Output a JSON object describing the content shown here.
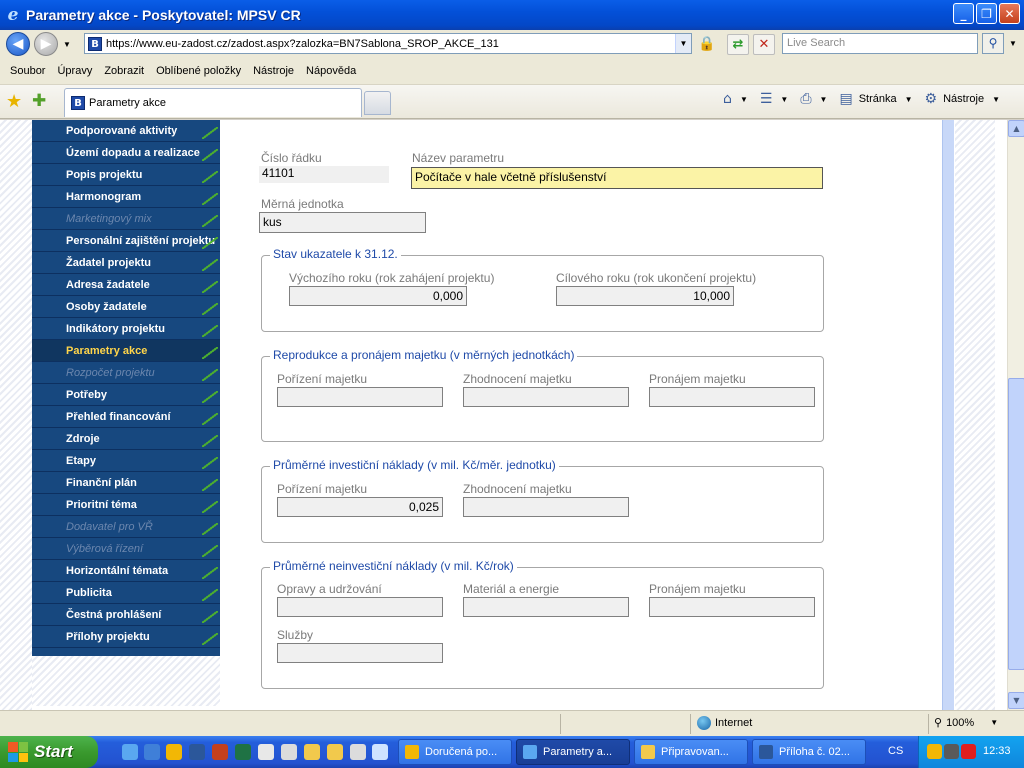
{
  "window": {
    "title": "Parametry akce - Poskytovatel: MPSV CR"
  },
  "address_bar": {
    "url": "https://www.eu-zadost.cz/zadost.aspx?zalozka=BN7Sablona_SROP_AKCE_131",
    "search_placeholder": "Live Search"
  },
  "menu": [
    "Soubor",
    "Úpravy",
    "Zobrazit",
    "Oblíbené položky",
    "Nástroje",
    "Nápověda"
  ],
  "tab": {
    "label": "Parametry akce"
  },
  "commands": {
    "page": "Stránka",
    "tools": "Nástroje"
  },
  "sidebar": {
    "items": [
      {
        "label": "Podporované aktivity",
        "state": "normal"
      },
      {
        "label": "Území dopadu a realizace",
        "state": "normal"
      },
      {
        "label": "Popis projektu",
        "state": "normal"
      },
      {
        "label": "Harmonogram",
        "state": "normal"
      },
      {
        "label": "Marketingový mix",
        "state": "disabled"
      },
      {
        "label": "Personální zajištění projektu",
        "state": "normal"
      },
      {
        "label": "Žadatel projektu",
        "state": "normal"
      },
      {
        "label": "Adresa žadatele",
        "state": "normal"
      },
      {
        "label": "Osoby žadatele",
        "state": "normal"
      },
      {
        "label": "Indikátory projektu",
        "state": "normal"
      },
      {
        "label": "Parametry akce",
        "state": "active"
      },
      {
        "label": "Rozpočet projektu",
        "state": "disabled"
      },
      {
        "label": "Potřeby",
        "state": "normal"
      },
      {
        "label": "Přehled financování",
        "state": "normal"
      },
      {
        "label": "Zdroje",
        "state": "normal"
      },
      {
        "label": "Etapy",
        "state": "normal"
      },
      {
        "label": "Finanční plán",
        "state": "normal"
      },
      {
        "label": "Prioritní téma",
        "state": "normal"
      },
      {
        "label": "Dodavatel pro VŘ",
        "state": "disabled"
      },
      {
        "label": "Výběrová řízení",
        "state": "disabled"
      },
      {
        "label": "Horizontální témata",
        "state": "normal"
      },
      {
        "label": "Publicita",
        "state": "normal"
      },
      {
        "label": "Čestná prohlášení",
        "state": "normal"
      },
      {
        "label": "Přílohy projektu",
        "state": "normal"
      }
    ]
  },
  "form": {
    "cislo_radku": {
      "label": "Číslo řádku",
      "value": "41101"
    },
    "nazev_parametru": {
      "label": "Název parametru",
      "value": "Počítače v hale včetně příslušenství"
    },
    "merna_jednotka": {
      "label": "Měrná jednotka",
      "value": "kus"
    },
    "stav_ukazatele": {
      "legend": "Stav ukazatele k 31.12.",
      "vychozi": {
        "label": "Výchozího roku (rok zahájení projektu)",
        "value": "0,000"
      },
      "cilovy": {
        "label": "Cílového roku (rok ukončení projektu)",
        "value": "10,000"
      }
    },
    "reprodukce": {
      "legend": "Reprodukce a pronájem majetku (v měrných jednotkách)",
      "porizeni": {
        "label": "Pořízení majetku",
        "value": ""
      },
      "zhodnoceni": {
        "label": "Zhodnocení majetku",
        "value": ""
      },
      "pronajem": {
        "label": "Pronájem majetku",
        "value": ""
      }
    },
    "investicni": {
      "legend": "Průměrné investiční náklady (v mil. Kč/měr. jednotku)",
      "porizeni": {
        "label": "Pořízení majetku",
        "value": "0,025"
      },
      "zhodnoceni": {
        "label": "Zhodnocení majetku",
        "value": ""
      }
    },
    "neinvesticni": {
      "legend": "Průměrné neinvestiční náklady (v mil. Kč/rok)",
      "opravy": {
        "label": "Opravy a udržování",
        "value": ""
      },
      "material": {
        "label": "Materiál a energie",
        "value": ""
      },
      "pronajem": {
        "label": "Pronájem majetku",
        "value": ""
      },
      "sluzby": {
        "label": "Služby",
        "value": ""
      }
    }
  },
  "status": {
    "zone": "Internet",
    "zoom": "100%"
  },
  "taskbar": {
    "start": "Start",
    "tasks": [
      {
        "label": "Doručená po...",
        "active": false,
        "color": "#f2b705"
      },
      {
        "label": "Parametry a...",
        "active": true,
        "color": "#5aa7f0"
      },
      {
        "label": "Připravovan...",
        "active": false,
        "color": "#f2c94c"
      },
      {
        "label": "Příloha č. 02...",
        "active": false,
        "color": "#2b579a"
      }
    ],
    "language": "CS",
    "clock": "12:33"
  },
  "colors": {
    "nav_bg": "#17487f",
    "nav_active_text": "#ffd54a",
    "legend": "#1f4aa8",
    "highlight_field": "#fbf3a6"
  }
}
